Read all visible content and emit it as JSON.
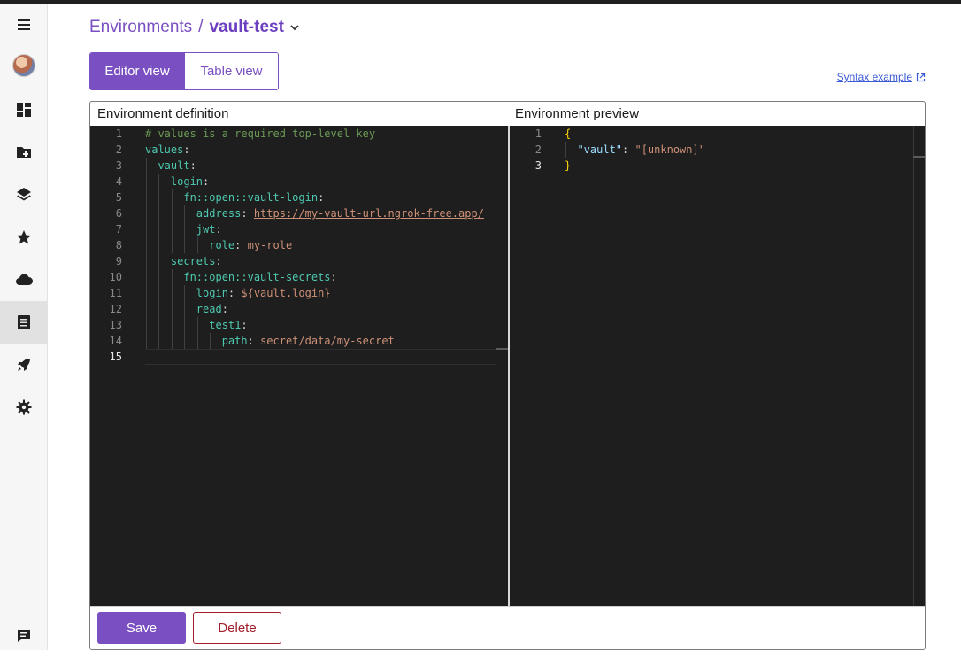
{
  "sidebar": {
    "items": [
      {
        "name": "menu-icon"
      },
      {
        "name": "avatar"
      },
      {
        "name": "dashboard-icon"
      },
      {
        "name": "add-folder-icon"
      },
      {
        "name": "layers-icon"
      },
      {
        "name": "star-icon"
      },
      {
        "name": "cloud-icon"
      },
      {
        "name": "environments-icon",
        "active": true
      },
      {
        "name": "rocket-icon"
      },
      {
        "name": "settings-icon"
      },
      {
        "name": "feedback-icon"
      }
    ]
  },
  "breadcrumb": {
    "parent": "Environments",
    "separator": "/",
    "current": "vault-test"
  },
  "view_toggle": {
    "editor": "Editor view",
    "table": "Table view",
    "selected": "editor"
  },
  "syntax_link": "Syntax example",
  "definition": {
    "title": "Environment definition",
    "current_line": 15,
    "lines": [
      "# values is a required top-level key",
      "values:",
      "  vault:",
      "    login:",
      "      fn::open::vault-login:",
      "        address: https://my-vault-url.ngrok-free.app/",
      "        jwt:",
      "          role: my-role",
      "    secrets:",
      "      fn::open::vault-secrets:",
      "        login: ${vault.login}",
      "        read:",
      "          test1:",
      "            path: secret/data/my-secret",
      ""
    ]
  },
  "preview": {
    "title": "Environment preview",
    "current_line": 3,
    "lines": [
      "{",
      "  \"vault\": \"[unknown]\"",
      "}"
    ]
  },
  "actions": {
    "save": "Save",
    "delete": "Delete"
  },
  "colors": {
    "accent": "#7a4fc1",
    "danger": "#a11e2b",
    "editor_bg": "#1e1e1e"
  }
}
